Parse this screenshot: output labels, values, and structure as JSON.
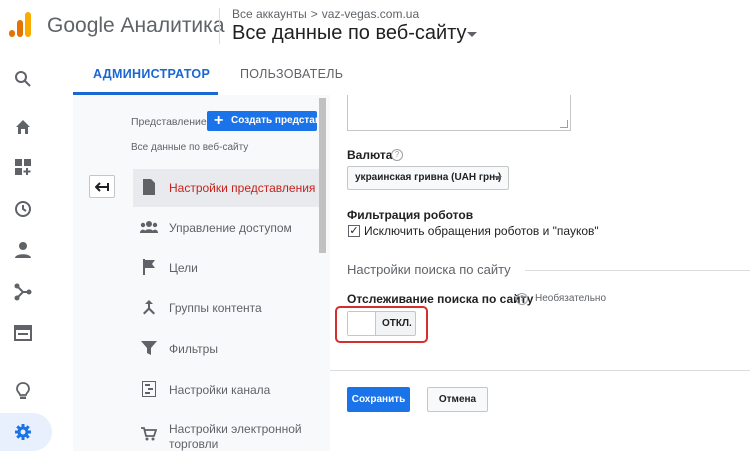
{
  "header": {
    "app_title": "Google Аналитика",
    "breadcrumb_root": "Все аккаунты",
    "breadcrumb_sep": ">",
    "breadcrumb_account": "vaz-vegas.com.ua",
    "view_title": "Все данные по веб-сайту"
  },
  "rail": {
    "icons": [
      "search-icon",
      "home-icon",
      "customization-icon",
      "realtime-clock-icon",
      "audience-person-icon",
      "acquisition-icon",
      "behavior-icon",
      "discover-bulb-icon",
      "admin-gear-icon"
    ],
    "selected": "admin-gear-icon"
  },
  "tabs": {
    "admin": "АДМИНИСТРАТОР",
    "user": "ПОЛЬЗОВАТЕЛЬ",
    "active": "admin"
  },
  "view_column": {
    "label": "Представление",
    "create_button": "Создать представл",
    "current_view": "Все данные по веб-сайту",
    "items": [
      {
        "label": "Настройки представления",
        "icon": "document-icon",
        "selected": true
      },
      {
        "label": "Управление доступом",
        "icon": "people-icon",
        "selected": false
      },
      {
        "label": "Цели",
        "icon": "flag-icon",
        "selected": false
      },
      {
        "label": "Группы контента",
        "icon": "merge-icon",
        "selected": false
      },
      {
        "label": "Фильтры",
        "icon": "filter-icon",
        "selected": false
      },
      {
        "label": "Настройки канала",
        "icon": "channel-icon",
        "selected": false
      },
      {
        "label": "Настройки электронной",
        "label_line2": "торговли",
        "icon": "cart-icon",
        "selected": false
      }
    ]
  },
  "settings": {
    "currency_label": "Валюта",
    "currency_value": "украинская гривна (UAH грн.)",
    "bot_filter_label": "Фильтрация роботов",
    "bot_filter_checkbox": "Исключить обращения роботов и \"пауков\"",
    "bot_filter_checked": true,
    "site_search_section": "Настройки поиска по сайту",
    "site_search_label": "Отслеживание поиска по сайту",
    "optional_text": "Необязательно",
    "toggle_state": "ОТКЛ.",
    "help_symbol": "?",
    "save_button": "Сохранить",
    "cancel_button": "Отмена"
  },
  "colors": {
    "accent": "#1a73e8",
    "selected_item_text": "#c5221f",
    "highlight_border": "#d32f2f"
  }
}
